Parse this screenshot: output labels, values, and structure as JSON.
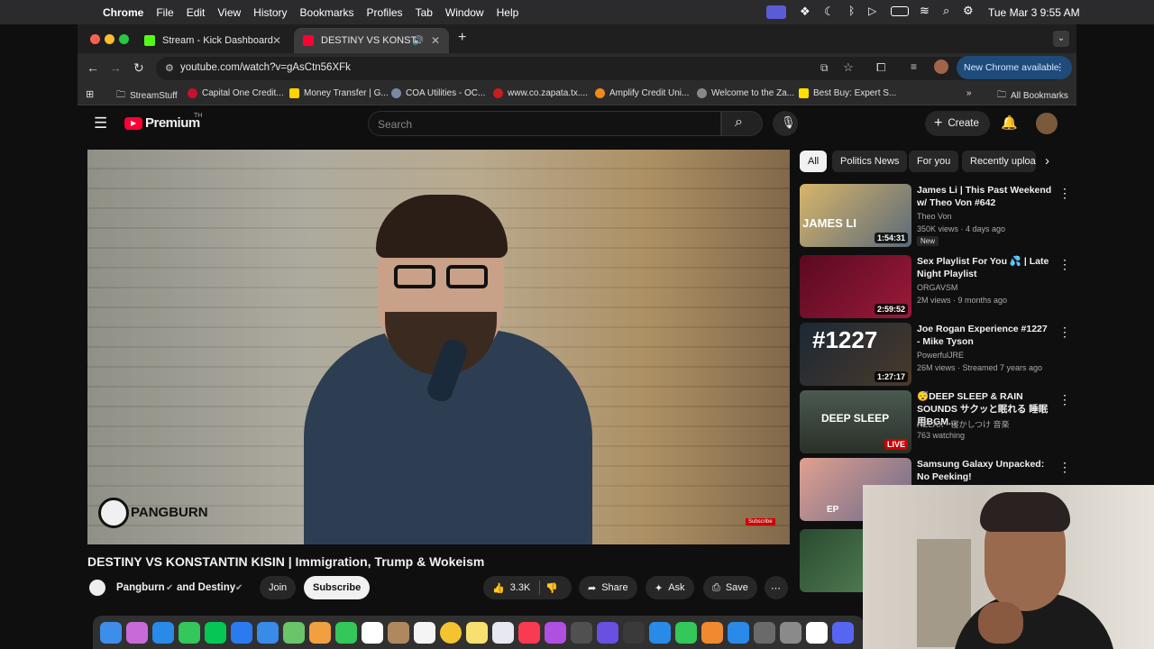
{
  "menubar": {
    "app": "Chrome",
    "items": [
      "File",
      "Edit",
      "View",
      "History",
      "Bookmarks",
      "Profiles",
      "Tab",
      "Window",
      "Help"
    ],
    "clock": "Tue Mar 3  9:55 AM"
  },
  "tabs": [
    {
      "title": "Stream - Kick Dashboard"
    },
    {
      "title": "DESTINY VS KONSTANTIN"
    }
  ],
  "address": {
    "url": "youtube.com/watch?v=gAsCtn56XFk"
  },
  "new_chrome": "New Chrome available",
  "bookmarks": {
    "items": [
      "StreamStuff",
      "Capital One Credit...",
      "Money Transfer | G...",
      "COA Utilities - OC...",
      "www.co.zapata.tx....",
      "Amplify Credit Uni...",
      "Welcome to the Za...",
      "Best Buy: Expert S..."
    ],
    "all_label": "All Bookmarks"
  },
  "youtube": {
    "logo": "Premium",
    "logo_sup": "TH",
    "search_placeholder": "Search",
    "create_label": "Create",
    "video": {
      "title": "DESTINY VS KONSTANTIN KISIN | Immigration, Trump & Wokeism",
      "watermark": "PANGBURN",
      "subscribe_tag": "Subscribe",
      "channel": "Pangburn",
      "collab": "and Destiny",
      "join": "Join",
      "subscribe": "Subscribe",
      "likes": "3.3K",
      "share": "Share",
      "ask": "Ask",
      "save": "Save"
    },
    "chips": [
      "All",
      "Politics News",
      "For you",
      "Recently uploa"
    ],
    "recs": [
      {
        "title": "James Li | This Past Weekend w/ Theo Von #642",
        "channel": "Theo Von",
        "meta": "350K views · 4 days ago",
        "badge": "New",
        "duration": "1:54:31",
        "thumb_text": "JAMES LI",
        "color": "#c89c4e"
      },
      {
        "title": "Sex Playlist For You 💦 | Late Night Playlist",
        "channel": "ORGAVSM",
        "meta": "2M views · 9 months ago",
        "badge": "",
        "duration": "2:59:52",
        "thumb_text": "",
        "color": "#7a1330"
      },
      {
        "title": "Joe Rogan Experience #1227 - Mike Tyson",
        "channel": "PowerfulJRE",
        "meta": "26M views · Streamed 7 years ago",
        "badge": "",
        "duration": "1:27:17",
        "thumb_text": "#1227",
        "color": "#2c3a4a"
      },
      {
        "title": "😴DEEP SLEEP & RAIN SOUNDS サクッと眠れる 睡眠用BGM...",
        "channel": "RELAX - 寝かしつけ 音楽",
        "meta": "763 watching",
        "badge": "",
        "duration": "LIVE",
        "thumb_text": "DEEP SLEEP",
        "color": "#3a4a3a"
      },
      {
        "title": "Samsung Galaxy Unpacked: No Peeking!",
        "channel": "",
        "meta": "",
        "badge": "",
        "duration": "",
        "thumb_text": "EP",
        "color": "#d88b7a"
      }
    ]
  }
}
